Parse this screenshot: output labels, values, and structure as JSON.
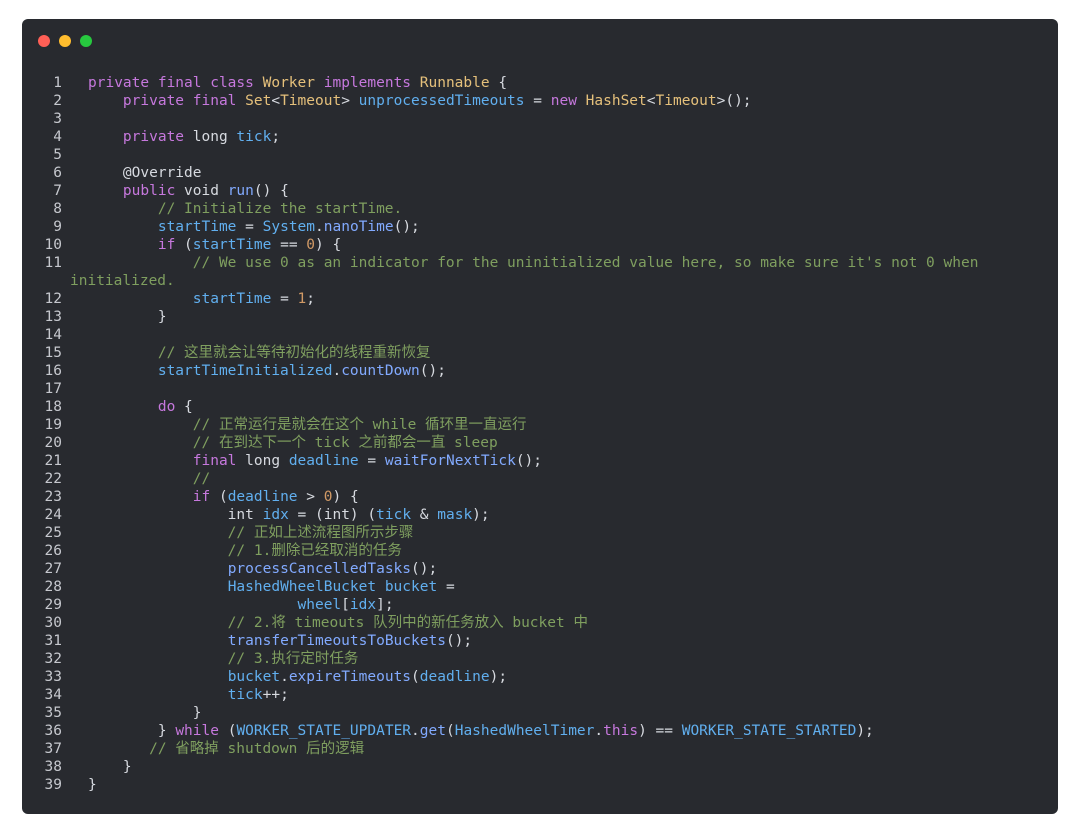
{
  "window": {
    "controls": [
      {
        "name": "close",
        "color": "#ff5f56"
      },
      {
        "name": "minimize",
        "color": "#ffbd2e"
      },
      {
        "name": "maximize",
        "color": "#27c93f"
      }
    ]
  },
  "code": {
    "lines": [
      {
        "n": "1",
        "segments": [
          {
            "t": "private final class ",
            "k": "kw"
          },
          {
            "t": "Worker",
            "k": "cls"
          },
          {
            "t": " implements ",
            "k": "kw"
          },
          {
            "t": "Runnable",
            "k": "cls"
          },
          {
            "t": " {",
            "k": "txt"
          }
        ]
      },
      {
        "n": "2",
        "segments": [
          {
            "t": "    ",
            "k": "txt"
          },
          {
            "t": "private final ",
            "k": "kw"
          },
          {
            "t": "Set",
            "k": "cls"
          },
          {
            "t": "<",
            "k": "txt"
          },
          {
            "t": "Timeout",
            "k": "cls"
          },
          {
            "t": "> ",
            "k": "txt"
          },
          {
            "t": "unprocessedTimeouts",
            "k": "var"
          },
          {
            "t": " = ",
            "k": "txt"
          },
          {
            "t": "new ",
            "k": "kw"
          },
          {
            "t": "HashSet",
            "k": "cls"
          },
          {
            "t": "<",
            "k": "txt"
          },
          {
            "t": "Timeout",
            "k": "cls"
          },
          {
            "t": ">();",
            "k": "txt"
          }
        ]
      },
      {
        "n": "3",
        "segments": []
      },
      {
        "n": "4",
        "segments": [
          {
            "t": "    ",
            "k": "txt"
          },
          {
            "t": "private ",
            "k": "kw"
          },
          {
            "t": "long ",
            "k": "txt"
          },
          {
            "t": "tick",
            "k": "var"
          },
          {
            "t": ";",
            "k": "txt"
          }
        ]
      },
      {
        "n": "5",
        "segments": []
      },
      {
        "n": "6",
        "segments": [
          {
            "t": "    @Override",
            "k": "ann"
          }
        ]
      },
      {
        "n": "7",
        "segments": [
          {
            "t": "    ",
            "k": "txt"
          },
          {
            "t": "public ",
            "k": "kw"
          },
          {
            "t": "void ",
            "k": "txt"
          },
          {
            "t": "run",
            "k": "fn"
          },
          {
            "t": "() {",
            "k": "txt"
          }
        ]
      },
      {
        "n": "8",
        "segments": [
          {
            "t": "        // Initialize the startTime.",
            "k": "cm"
          }
        ]
      },
      {
        "n": "9",
        "segments": [
          {
            "t": "        ",
            "k": "txt"
          },
          {
            "t": "startTime",
            "k": "var"
          },
          {
            "t": " = ",
            "k": "txt"
          },
          {
            "t": "System",
            "k": "var"
          },
          {
            "t": ".",
            "k": "txt"
          },
          {
            "t": "nanoTime",
            "k": "fn"
          },
          {
            "t": "();",
            "k": "txt"
          }
        ]
      },
      {
        "n": "10",
        "segments": [
          {
            "t": "        ",
            "k": "txt"
          },
          {
            "t": "if ",
            "k": "kw"
          },
          {
            "t": "(",
            "k": "txt"
          },
          {
            "t": "startTime",
            "k": "var"
          },
          {
            "t": " == ",
            "k": "txt"
          },
          {
            "t": "0",
            "k": "num"
          },
          {
            "t": ") {",
            "k": "txt"
          }
        ]
      },
      {
        "n": "11",
        "segments": [
          {
            "t": "            // We use 0 as an indicator for the uninitialized value here, so make sure it's not 0 when",
            "k": "cm"
          }
        ]
      },
      {
        "n": "",
        "cont": true,
        "segments": [
          {
            "t": "initialized.",
            "k": "cm"
          }
        ]
      },
      {
        "n": "12",
        "segments": [
          {
            "t": "            ",
            "k": "txt"
          },
          {
            "t": "startTime",
            "k": "var"
          },
          {
            "t": " = ",
            "k": "txt"
          },
          {
            "t": "1",
            "k": "num"
          },
          {
            "t": ";",
            "k": "txt"
          }
        ]
      },
      {
        "n": "13",
        "segments": [
          {
            "t": "        }",
            "k": "txt"
          }
        ]
      },
      {
        "n": "14",
        "segments": []
      },
      {
        "n": "15",
        "segments": [
          {
            "t": "        // 这里就会让等待初始化的线程重新恢复",
            "k": "cm"
          }
        ]
      },
      {
        "n": "16",
        "segments": [
          {
            "t": "        ",
            "k": "txt"
          },
          {
            "t": "startTimeInitialized",
            "k": "var"
          },
          {
            "t": ".",
            "k": "txt"
          },
          {
            "t": "countDown",
            "k": "fn"
          },
          {
            "t": "();",
            "k": "txt"
          }
        ]
      },
      {
        "n": "17",
        "segments": []
      },
      {
        "n": "18",
        "segments": [
          {
            "t": "        ",
            "k": "txt"
          },
          {
            "t": "do",
            "k": "kw"
          },
          {
            "t": " {",
            "k": "txt"
          }
        ]
      },
      {
        "n": "19",
        "segments": [
          {
            "t": "            // 正常运行是就会在这个 while 循环里一直运行",
            "k": "cm"
          }
        ]
      },
      {
        "n": "20",
        "segments": [
          {
            "t": "            // 在到达下一个 tick 之前都会一直 sleep",
            "k": "cm"
          }
        ]
      },
      {
        "n": "21",
        "segments": [
          {
            "t": "            ",
            "k": "txt"
          },
          {
            "t": "final ",
            "k": "kw"
          },
          {
            "t": "long ",
            "k": "txt"
          },
          {
            "t": "deadline",
            "k": "var"
          },
          {
            "t": " = ",
            "k": "txt"
          },
          {
            "t": "waitForNextTick",
            "k": "fn"
          },
          {
            "t": "();",
            "k": "txt"
          }
        ]
      },
      {
        "n": "22",
        "segments": [
          {
            "t": "            //",
            "k": "cm"
          }
        ]
      },
      {
        "n": "23",
        "segments": [
          {
            "t": "            ",
            "k": "txt"
          },
          {
            "t": "if ",
            "k": "kw"
          },
          {
            "t": "(",
            "k": "txt"
          },
          {
            "t": "deadline",
            "k": "var"
          },
          {
            "t": " > ",
            "k": "txt"
          },
          {
            "t": "0",
            "k": "num"
          },
          {
            "t": ") {",
            "k": "txt"
          }
        ]
      },
      {
        "n": "24",
        "segments": [
          {
            "t": "                int ",
            "k": "txt"
          },
          {
            "t": "idx",
            "k": "var"
          },
          {
            "t": " = (int) (",
            "k": "txt"
          },
          {
            "t": "tick",
            "k": "var"
          },
          {
            "t": " & ",
            "k": "txt"
          },
          {
            "t": "mask",
            "k": "var"
          },
          {
            "t": ");",
            "k": "txt"
          }
        ]
      },
      {
        "n": "25",
        "segments": [
          {
            "t": "                // 正如上述流程图所示步骤",
            "k": "cm"
          }
        ]
      },
      {
        "n": "26",
        "segments": [
          {
            "t": "                // 1.删除已经取消的任务",
            "k": "cm"
          }
        ]
      },
      {
        "n": "27",
        "segments": [
          {
            "t": "                ",
            "k": "txt"
          },
          {
            "t": "processCancelledTasks",
            "k": "fn"
          },
          {
            "t": "();",
            "k": "txt"
          }
        ]
      },
      {
        "n": "28",
        "segments": [
          {
            "t": "                ",
            "k": "txt"
          },
          {
            "t": "HashedWheelBucket",
            "k": "var"
          },
          {
            "t": " ",
            "k": "txt"
          },
          {
            "t": "bucket",
            "k": "var"
          },
          {
            "t": " =",
            "k": "txt"
          }
        ]
      },
      {
        "n": "29",
        "segments": [
          {
            "t": "                        ",
            "k": "txt"
          },
          {
            "t": "wheel",
            "k": "var"
          },
          {
            "t": "[",
            "k": "txt"
          },
          {
            "t": "idx",
            "k": "var"
          },
          {
            "t": "];",
            "k": "txt"
          }
        ]
      },
      {
        "n": "30",
        "segments": [
          {
            "t": "                // 2.将 timeouts 队列中的新任务放入 bucket 中",
            "k": "cm"
          }
        ]
      },
      {
        "n": "31",
        "segments": [
          {
            "t": "                ",
            "k": "txt"
          },
          {
            "t": "transferTimeoutsToBuckets",
            "k": "fn"
          },
          {
            "t": "();",
            "k": "txt"
          }
        ]
      },
      {
        "n": "32",
        "segments": [
          {
            "t": "                // 3.执行定时任务",
            "k": "cm"
          }
        ]
      },
      {
        "n": "33",
        "segments": [
          {
            "t": "                ",
            "k": "txt"
          },
          {
            "t": "bucket",
            "k": "var"
          },
          {
            "t": ".",
            "k": "txt"
          },
          {
            "t": "expireTimeouts",
            "k": "fn"
          },
          {
            "t": "(",
            "k": "txt"
          },
          {
            "t": "deadline",
            "k": "var"
          },
          {
            "t": ");",
            "k": "txt"
          }
        ]
      },
      {
        "n": "34",
        "segments": [
          {
            "t": "                ",
            "k": "txt"
          },
          {
            "t": "tick",
            "k": "var"
          },
          {
            "t": "++;",
            "k": "txt"
          }
        ]
      },
      {
        "n": "35",
        "segments": [
          {
            "t": "            }",
            "k": "txt"
          }
        ]
      },
      {
        "n": "36",
        "segments": [
          {
            "t": "        } ",
            "k": "txt"
          },
          {
            "t": "while",
            "k": "kw"
          },
          {
            "t": " (",
            "k": "txt"
          },
          {
            "t": "WORKER_STATE_UPDATER",
            "k": "var"
          },
          {
            "t": ".",
            "k": "txt"
          },
          {
            "t": "get",
            "k": "fn"
          },
          {
            "t": "(",
            "k": "txt"
          },
          {
            "t": "HashedWheelTimer",
            "k": "var"
          },
          {
            "t": ".",
            "k": "txt"
          },
          {
            "t": "this",
            "k": "kw"
          },
          {
            "t": ") == ",
            "k": "txt"
          },
          {
            "t": "WORKER_STATE_STARTED",
            "k": "var"
          },
          {
            "t": ");",
            "k": "txt"
          }
        ]
      },
      {
        "n": "37",
        "segments": [
          {
            "t": "       // 省略掉 shutdown 后的逻辑",
            "k": "cm"
          }
        ]
      },
      {
        "n": "38",
        "segments": [
          {
            "t": "    }",
            "k": "txt"
          }
        ]
      },
      {
        "n": "39",
        "segments": [
          {
            "t": "}",
            "k": "txt"
          }
        ]
      }
    ]
  }
}
